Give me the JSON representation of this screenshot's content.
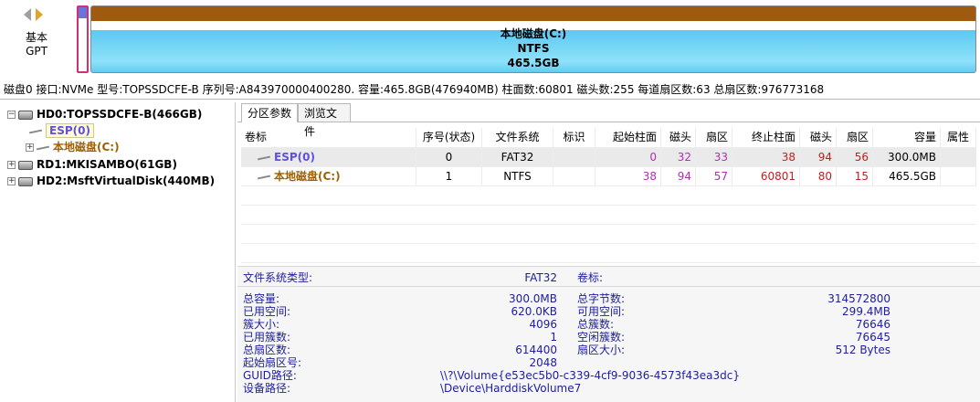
{
  "disk_bar": {
    "disk_kind": "基本",
    "partition_style": "GPT",
    "partition_label": "本地磁盘(C:)",
    "partition_fs": "NTFS",
    "partition_size": "465.5GB",
    "colors": {
      "esp": "#6a74d8",
      "ntfs_top": "#a05a10",
      "ntfs_body": "#5cc8f0",
      "esp_border": "#d0307a"
    }
  },
  "disk_info_line": "磁盘0 接口:NVMe  型号:TOPSSDCFE-B  序列号:A843970000400280.  容量:465.8GB(476940MB)  柱面数:60801  磁头数:255  每道扇区数:63  总扇区数:976773168",
  "tree": {
    "disks": [
      {
        "label": "HD0:TOPSSDCFE-B(466GB)",
        "expand": "−"
      },
      {
        "label": "RD1:MKISAMBO(61GB)",
        "expand": "+"
      },
      {
        "label": "HD2:MsftVirtualDisk(440MB)",
        "expand": "+"
      }
    ],
    "partitions": [
      {
        "label": "ESP(0)"
      },
      {
        "label": "本地磁盘(C:)",
        "expand": "+"
      }
    ]
  },
  "tabs": [
    "分区参数",
    "浏览文件"
  ],
  "table": {
    "headers": [
      "卷标",
      "序号(状态)",
      "文件系统",
      "标识",
      "起始柱面",
      "磁头",
      "扇区",
      "终止柱面",
      "磁头",
      "扇区",
      "容量",
      "属性"
    ],
    "rows": [
      {
        "label": "ESP(0)",
        "index": "0",
        "fs": "FAT32",
        "flag": "",
        "start_cyl": "0",
        "start_head": "32",
        "start_sec": "33",
        "end_cyl": "38",
        "end_head": "94",
        "end_sec": "56",
        "size": "300.0MB",
        "attr": ""
      },
      {
        "label": "本地磁盘(C:)",
        "index": "1",
        "fs": "NTFS",
        "flag": "",
        "start_cyl": "38",
        "start_head": "94",
        "start_sec": "57",
        "end_cyl": "60801",
        "end_head": "80",
        "end_sec": "15",
        "size": "465.5GB",
        "attr": ""
      }
    ]
  },
  "details": {
    "fs_type_label": "文件系统类型:",
    "fs_type_value": "FAT32",
    "volume_label_label": "卷标:",
    "left": [
      {
        "label": "总容量:",
        "value": "300.0MB"
      },
      {
        "label": "已用空间:",
        "value": "620.0KB"
      },
      {
        "label": "簇大小:",
        "value": "4096"
      },
      {
        "label": "已用簇数:",
        "value": "1"
      },
      {
        "label": "总扇区数:",
        "value": "614400"
      },
      {
        "label": "起始扇区号:",
        "value": "2048"
      }
    ],
    "right": [
      {
        "label": "总字节数:",
        "value": "314572800"
      },
      {
        "label": "可用空间:",
        "value": "299.4MB"
      },
      {
        "label": "总簇数:",
        "value": "76646"
      },
      {
        "label": "空闲簇数:",
        "value": "76645"
      },
      {
        "label": "扇区大小:",
        "value": "512 Bytes"
      }
    ],
    "guid_label": "GUID路径:",
    "guid_value": "\\\\?\\Volume{e53ec5b0-c339-4cf9-9036-4573f43ea3dc}",
    "device_label": "设备路径:",
    "device_value": "\\Device\\HarddiskVolume7"
  }
}
